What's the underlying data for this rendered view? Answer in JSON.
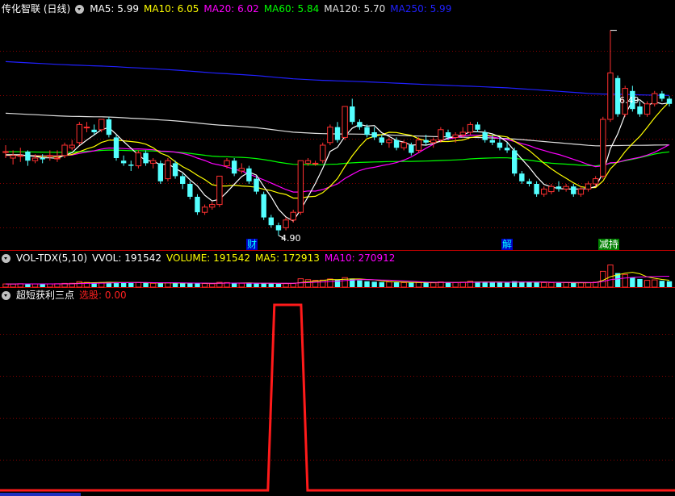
{
  "main": {
    "title": "传化智联 (日线)",
    "indicators": [
      {
        "label": "MA5: 5.99",
        "color": "#ffffff"
      },
      {
        "label": "MA10: 6.05",
        "color": "#ffff00"
      },
      {
        "label": "MA20: 6.02",
        "color": "#ff00ff"
      },
      {
        "label": "MA60: 5.84",
        "color": "#00ff00"
      },
      {
        "label": "MA120: 5.70",
        "color": "#e0e0e0"
      },
      {
        "label": "MA250: 5.99",
        "color": "#2020ff"
      }
    ],
    "price_high": "6.49",
    "price_low": "4.90",
    "event_tags": [
      {
        "label": "财",
        "color": "#00ffff",
        "bg": "#0000c8"
      },
      {
        "label": "解",
        "color": "#00ffff",
        "bg": "#0000c8"
      },
      {
        "label": "减持",
        "color": "#ffffff",
        "bg": "#008000",
        "accent": "#ff3030"
      }
    ]
  },
  "volume": {
    "title": "VOL-TDX(5,10)",
    "indicators": [
      {
        "label": "VVOL: 191542",
        "color": "#ffffff"
      },
      {
        "label": "VOLUME: 191542",
        "color": "#ffff00"
      },
      {
        "label": "MA5: 172913",
        "color": "#ffff00"
      },
      {
        "label": "MA10: 270912",
        "color": "#ff00ff"
      }
    ]
  },
  "signal": {
    "title": "超短获利三点",
    "indicators": [
      {
        "label": "选股: 0.00",
        "color": "#ff2020"
      }
    ]
  },
  "chart_data": {
    "type": "candlestick",
    "candles": [
      {
        "o": 5.55,
        "h": 5.6,
        "l": 5.5,
        "c": 5.55
      },
      {
        "o": 5.5,
        "h": 5.56,
        "l": 5.45,
        "c": 5.52
      },
      {
        "o": 5.52,
        "h": 5.58,
        "l": 5.47,
        "c": 5.52
      },
      {
        "o": 5.55,
        "h": 5.56,
        "l": 5.44,
        "c": 5.48
      },
      {
        "o": 5.48,
        "h": 5.53,
        "l": 5.46,
        "c": 5.5
      },
      {
        "o": 5.5,
        "h": 5.53,
        "l": 5.46,
        "c": 5.49
      },
      {
        "o": 5.52,
        "h": 5.56,
        "l": 5.48,
        "c": 5.52
      },
      {
        "o": 5.5,
        "h": 5.56,
        "l": 5.47,
        "c": 5.5
      },
      {
        "o": 5.52,
        "h": 5.62,
        "l": 5.5,
        "c": 5.6
      },
      {
        "o": 5.58,
        "h": 5.64,
        "l": 5.56,
        "c": 5.6
      },
      {
        "o": 5.62,
        "h": 5.78,
        "l": 5.6,
        "c": 5.76
      },
      {
        "o": 5.74,
        "h": 5.78,
        "l": 5.7,
        "c": 5.74
      },
      {
        "o": 5.72,
        "h": 5.76,
        "l": 5.68,
        "c": 5.7
      },
      {
        "o": 5.72,
        "h": 5.8,
        "l": 5.7,
        "c": 5.8
      },
      {
        "o": 5.8,
        "h": 5.82,
        "l": 5.66,
        "c": 5.68
      },
      {
        "o": 5.66,
        "h": 5.68,
        "l": 5.48,
        "c": 5.5
      },
      {
        "o": 5.48,
        "h": 5.52,
        "l": 5.44,
        "c": 5.46
      },
      {
        "o": 5.45,
        "h": 5.48,
        "l": 5.4,
        "c": 5.44
      },
      {
        "o": 5.44,
        "h": 5.56,
        "l": 5.42,
        "c": 5.54
      },
      {
        "o": 5.54,
        "h": 5.56,
        "l": 5.44,
        "c": 5.46
      },
      {
        "o": 5.46,
        "h": 5.5,
        "l": 5.42,
        "c": 5.48
      },
      {
        "o": 5.46,
        "h": 5.48,
        "l": 5.3,
        "c": 5.32
      },
      {
        "o": 5.34,
        "h": 5.5,
        "l": 5.32,
        "c": 5.48
      },
      {
        "o": 5.46,
        "h": 5.48,
        "l": 5.34,
        "c": 5.36
      },
      {
        "o": 5.36,
        "h": 5.38,
        "l": 5.26,
        "c": 5.3
      },
      {
        "o": 5.3,
        "h": 5.32,
        "l": 5.18,
        "c": 5.2
      },
      {
        "o": 5.2,
        "h": 5.22,
        "l": 5.06,
        "c": 5.08
      },
      {
        "o": 5.08,
        "h": 5.14,
        "l": 5.06,
        "c": 5.12
      },
      {
        "o": 5.12,
        "h": 5.16,
        "l": 5.1,
        "c": 5.14
      },
      {
        "o": 5.14,
        "h": 5.36,
        "l": 5.12,
        "c": 5.36
      },
      {
        "o": 5.44,
        "h": 5.5,
        "l": 5.42,
        "c": 5.48
      },
      {
        "o": 5.48,
        "h": 5.5,
        "l": 5.36,
        "c": 5.38
      },
      {
        "o": 5.4,
        "h": 5.46,
        "l": 5.38,
        "c": 5.42
      },
      {
        "o": 5.42,
        "h": 5.44,
        "l": 5.3,
        "c": 5.32
      },
      {
        "o": 5.34,
        "h": 5.36,
        "l": 5.22,
        "c": 5.24
      },
      {
        "o": 5.22,
        "h": 5.24,
        "l": 5.02,
        "c": 5.04
      },
      {
        "o": 5.04,
        "h": 5.06,
        "l": 4.96,
        "c": 4.98
      },
      {
        "o": 4.98,
        "h": 5.0,
        "l": 4.9,
        "c": 4.94
      },
      {
        "o": 4.96,
        "h": 5.04,
        "l": 4.94,
        "c": 5.02
      },
      {
        "o": 5.02,
        "h": 5.1,
        "l": 5.0,
        "c": 5.08
      },
      {
        "o": 5.08,
        "h": 5.48,
        "l": 5.06,
        "c": 5.48
      },
      {
        "o": 5.46,
        "h": 5.5,
        "l": 5.44,
        "c": 5.48
      },
      {
        "o": 5.46,
        "h": 5.48,
        "l": 5.44,
        "c": 5.46
      },
      {
        "o": 5.48,
        "h": 5.62,
        "l": 5.46,
        "c": 5.6
      },
      {
        "o": 5.62,
        "h": 5.76,
        "l": 5.6,
        "c": 5.74
      },
      {
        "o": 5.74,
        "h": 5.78,
        "l": 5.62,
        "c": 5.64
      },
      {
        "o": 5.66,
        "h": 5.9,
        "l": 5.64,
        "c": 5.9
      },
      {
        "o": 5.9,
        "h": 5.96,
        "l": 5.76,
        "c": 5.78
      },
      {
        "o": 5.78,
        "h": 5.8,
        "l": 5.72,
        "c": 5.74
      },
      {
        "o": 5.74,
        "h": 5.76,
        "l": 5.66,
        "c": 5.68
      },
      {
        "o": 5.7,
        "h": 5.74,
        "l": 5.64,
        "c": 5.66
      },
      {
        "o": 5.66,
        "h": 5.68,
        "l": 5.6,
        "c": 5.62
      },
      {
        "o": 5.62,
        "h": 5.66,
        "l": 5.58,
        "c": 5.64
      },
      {
        "o": 5.64,
        "h": 5.66,
        "l": 5.56,
        "c": 5.58
      },
      {
        "o": 5.58,
        "h": 5.64,
        "l": 5.56,
        "c": 5.62
      },
      {
        "o": 5.6,
        "h": 5.62,
        "l": 5.52,
        "c": 5.54
      },
      {
        "o": 5.56,
        "h": 5.66,
        "l": 5.54,
        "c": 5.64
      },
      {
        "o": 5.64,
        "h": 5.68,
        "l": 5.6,
        "c": 5.62
      },
      {
        "o": 5.62,
        "h": 5.66,
        "l": 5.58,
        "c": 5.64
      },
      {
        "o": 5.64,
        "h": 5.74,
        "l": 5.62,
        "c": 5.72
      },
      {
        "o": 5.7,
        "h": 5.72,
        "l": 5.64,
        "c": 5.66
      },
      {
        "o": 5.66,
        "h": 5.7,
        "l": 5.62,
        "c": 5.68
      },
      {
        "o": 5.68,
        "h": 5.74,
        "l": 5.66,
        "c": 5.7
      },
      {
        "o": 5.7,
        "h": 5.78,
        "l": 5.68,
        "c": 5.76
      },
      {
        "o": 5.76,
        "h": 5.78,
        "l": 5.7,
        "c": 5.72
      },
      {
        "o": 5.7,
        "h": 5.72,
        "l": 5.62,
        "c": 5.64
      },
      {
        "o": 5.64,
        "h": 5.68,
        "l": 5.6,
        "c": 5.62
      },
      {
        "o": 5.62,
        "h": 5.66,
        "l": 5.56,
        "c": 5.58
      },
      {
        "o": 5.58,
        "h": 5.62,
        "l": 5.54,
        "c": 5.56
      },
      {
        "o": 5.56,
        "h": 5.58,
        "l": 5.36,
        "c": 5.38
      },
      {
        "o": 5.38,
        "h": 5.4,
        "l": 5.3,
        "c": 5.32
      },
      {
        "o": 5.32,
        "h": 5.34,
        "l": 5.28,
        "c": 5.3
      },
      {
        "o": 5.3,
        "h": 5.32,
        "l": 5.2,
        "c": 5.22
      },
      {
        "o": 5.22,
        "h": 5.28,
        "l": 5.2,
        "c": 5.26
      },
      {
        "o": 5.24,
        "h": 5.3,
        "l": 5.22,
        "c": 5.28
      },
      {
        "o": 5.28,
        "h": 5.32,
        "l": 5.24,
        "c": 5.26
      },
      {
        "o": 5.26,
        "h": 5.3,
        "l": 5.24,
        "c": 5.28
      },
      {
        "o": 5.28,
        "h": 5.3,
        "l": 5.2,
        "c": 5.22
      },
      {
        "o": 5.22,
        "h": 5.28,
        "l": 5.2,
        "c": 5.26
      },
      {
        "o": 5.26,
        "h": 5.32,
        "l": 5.24,
        "c": 5.3
      },
      {
        "o": 5.3,
        "h": 5.36,
        "l": 5.28,
        "c": 5.34
      },
      {
        "o": 5.36,
        "h": 5.82,
        "l": 5.34,
        "c": 5.8
      },
      {
        "o": 5.8,
        "h": 6.49,
        "l": 5.78,
        "c": 6.16
      },
      {
        "o": 6.12,
        "h": 6.14,
        "l": 5.82,
        "c": 5.84
      },
      {
        "o": 5.84,
        "h": 6.06,
        "l": 5.82,
        "c": 6.04
      },
      {
        "o": 6.02,
        "h": 6.06,
        "l": 5.86,
        "c": 5.88
      },
      {
        "o": 5.9,
        "h": 5.94,
        "l": 5.82,
        "c": 5.84
      },
      {
        "o": 5.84,
        "h": 5.94,
        "l": 5.82,
        "c": 5.92
      },
      {
        "o": 5.92,
        "h": 6.02,
        "l": 5.9,
        "c": 6.0
      },
      {
        "o": 6.0,
        "h": 6.02,
        "l": 5.94,
        "c": 5.96
      },
      {
        "o": 5.96,
        "h": 5.98,
        "l": 5.9,
        "c": 5.92
      }
    ],
    "volumes": [
      140000,
      135000,
      150000,
      145000,
      138000,
      140000,
      142000,
      150000,
      165000,
      170000,
      240000,
      210000,
      190000,
      200000,
      230000,
      215000,
      190000,
      180000,
      200000,
      185000,
      170000,
      175000,
      190000,
      185000,
      170000,
      165000,
      180000,
      160000,
      150000,
      210000,
      200000,
      180000,
      170000,
      165000,
      160000,
      175000,
      168000,
      150000,
      155000,
      165000,
      370000,
      330000,
      300000,
      310000,
      360000,
      340000,
      420000,
      380000,
      300000,
      260000,
      240000,
      220000,
      230000,
      210000,
      200000,
      195000,
      205000,
      200000,
      190000,
      230000,
      210000,
      200000,
      220000,
      260000,
      240000,
      220000,
      210000,
      205000,
      195000,
      260000,
      240000,
      220000,
      210000,
      200000,
      195000,
      190000,
      200000,
      185000,
      195000,
      200000,
      220000,
      700000,
      980000,
      620000,
      560000,
      430000,
      360000,
      300000,
      320000,
      280000,
      260000
    ],
    "signal": [
      0,
      0,
      0,
      0,
      0,
      0,
      0,
      0,
      0,
      0,
      0,
      0,
      0,
      0,
      0,
      0,
      0,
      0,
      0,
      0,
      0,
      0,
      0,
      0,
      0,
      0,
      0,
      0,
      0,
      0,
      0,
      0,
      0,
      0,
      0,
      0,
      0,
      0,
      0,
      0,
      0,
      0,
      0,
      0,
      0,
      0,
      0,
      0,
      0,
      0,
      0,
      0,
      0,
      0,
      0,
      0,
      0,
      0,
      0,
      0,
      0,
      0,
      0,
      0,
      0,
      0,
      0,
      0,
      0,
      0,
      0,
      0,
      0,
      0,
      0,
      0,
      0,
      0,
      0,
      0,
      0,
      0,
      0,
      0,
      0,
      0,
      0,
      0,
      0,
      0,
      0,
      0
    ],
    "signal_pulse": {
      "start": 36.0,
      "end": 40.5,
      "level": 1
    },
    "ma_colors": {
      "ma5": "#ffffff",
      "ma10": "#ffff00",
      "ma20": "#ff00ff",
      "ma60": "#00ff00",
      "ma120": "#e0e0e0",
      "ma250": "#2020ff"
    },
    "up_color": "#ff3030",
    "down_color": "#54ffff",
    "grid_color": "#8a0000",
    "divider_color": "#c00000",
    "ylim": [
      4.8,
      6.6
    ]
  }
}
